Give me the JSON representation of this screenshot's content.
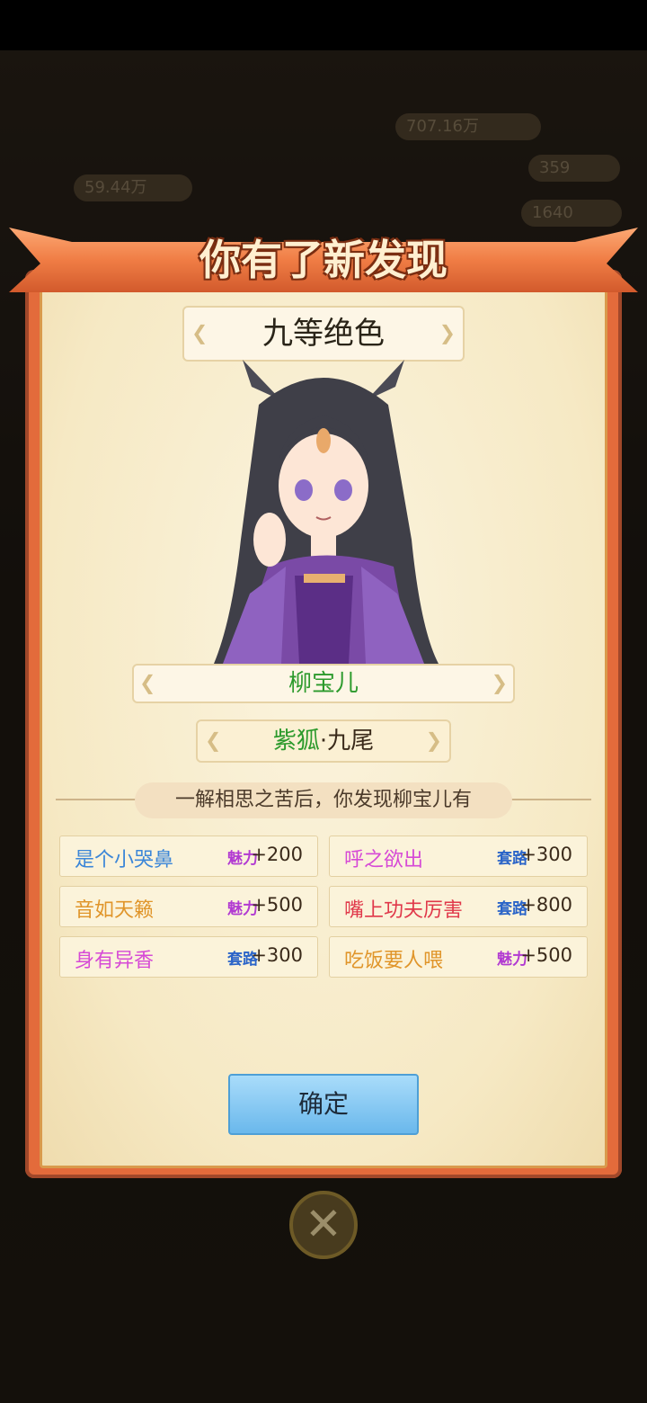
{
  "dialog": {
    "title": "你有了新发现",
    "rank": "九等绝色",
    "character_name": "柳宝儿",
    "type_main": "紫狐",
    "type_sep": "·",
    "type_sub": "九尾",
    "description": "一解相思之苦后，你发现柳宝儿有",
    "confirm_label": "确定",
    "close_symbol": "✕"
  },
  "traits": [
    {
      "name": "是个小哭鼻",
      "name_color": "#3b86d8",
      "tag": "魅力",
      "tag_color": "#b23bd2",
      "value": "+200"
    },
    {
      "name": "呼之欲出",
      "name_color": "#d64ad6",
      "tag": "套路",
      "tag_color": "#2a64c8",
      "value": "+300"
    },
    {
      "name": "音如天籁",
      "name_color": "#e0952a",
      "tag": "魅力",
      "tag_color": "#b23bd2",
      "value": "+500"
    },
    {
      "name": "嘴上功夫厉害",
      "name_color": "#e0384a",
      "tag": "套路",
      "tag_color": "#2a64c8",
      "value": "+800"
    },
    {
      "name": "身有异香",
      "name_color": "#d64ad6",
      "tag": "套路",
      "tag_color": "#2a64c8",
      "value": "+300"
    },
    {
      "name": "吃饭要人喂",
      "name_color": "#e0952a",
      "tag": "魅力",
      "tag_color": "#b23bd2",
      "value": "+500"
    }
  ],
  "background": {
    "stat_a": "59.44万",
    "stat_b": "707.16万",
    "stat_c": "359",
    "stat_d": "1640"
  }
}
